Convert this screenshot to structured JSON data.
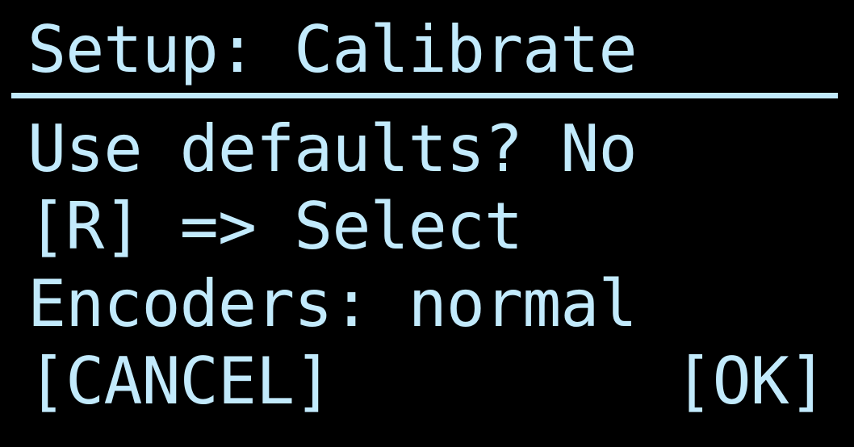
{
  "screen": {
    "title": "Setup: Calibrate",
    "use_defaults_line": "Use defaults? No",
    "select_hint": "[R] => Select",
    "encoders_line": "Encoders: normal",
    "cancel_label": "[CANCEL]",
    "ok_label": "[OK]"
  },
  "colors": {
    "background": "#000000",
    "text": "#c2eafc"
  }
}
